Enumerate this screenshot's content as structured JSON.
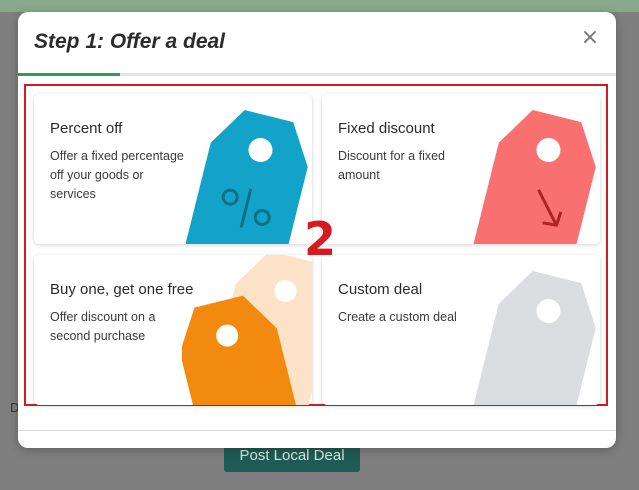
{
  "background": {
    "letter": "D",
    "post_button_label": "Post Local Deal"
  },
  "modal": {
    "title": "Step 1: Offer a deal",
    "close_glyph": "×",
    "progress_fraction": 0.17,
    "annotation": "2",
    "colors": {
      "progress": "#2a9d53",
      "highlight_border": "#d71920",
      "tag_percent": "#13a3c9",
      "tag_fixed": "#f87070",
      "tag_bogo_back": "#fce3c8",
      "tag_bogo_front": "#f38a10",
      "tag_custom": "#dcdde0"
    },
    "cards": [
      {
        "title": "Percent off",
        "description": "Offer a fixed percentage off your goods or services",
        "icon": "percent-tag-icon"
      },
      {
        "title": "Fixed discount",
        "description": "Discount for a fixed amount",
        "icon": "discount-arrow-tag-icon"
      },
      {
        "title": "Buy one, get one free",
        "description": "Offer discount on a second purchase",
        "icon": "double-tag-icon"
      },
      {
        "title": "Custom deal",
        "description": "Create a custom deal",
        "icon": "blank-tag-icon"
      }
    ]
  }
}
